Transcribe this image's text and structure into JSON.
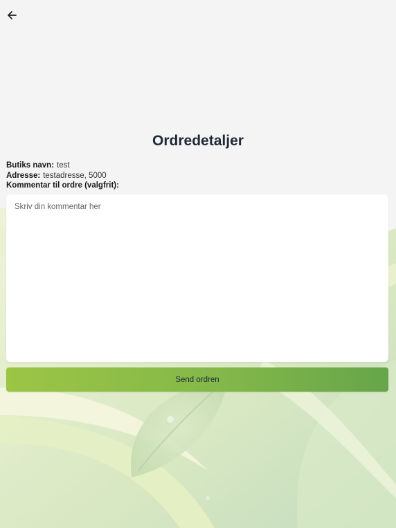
{
  "header": {
    "back_icon": "arrow-left-icon"
  },
  "page": {
    "title": "Ordredetaljer"
  },
  "details": {
    "shop_name_label": "Butiks navn:",
    "shop_name_value": "test",
    "address_label": "Adresse:",
    "address_value": "testadresse, 5000",
    "comment_label": "Kommentar til ordre (valgfrit):"
  },
  "comment": {
    "value": "",
    "placeholder": "Skriv din kommentar her"
  },
  "actions": {
    "send_label": "Send ordren"
  },
  "colors": {
    "background": "#f4f4f4",
    "button_gradient_start": "#9cc545",
    "button_gradient_end": "#67a54b",
    "title": "#1f2a38"
  }
}
